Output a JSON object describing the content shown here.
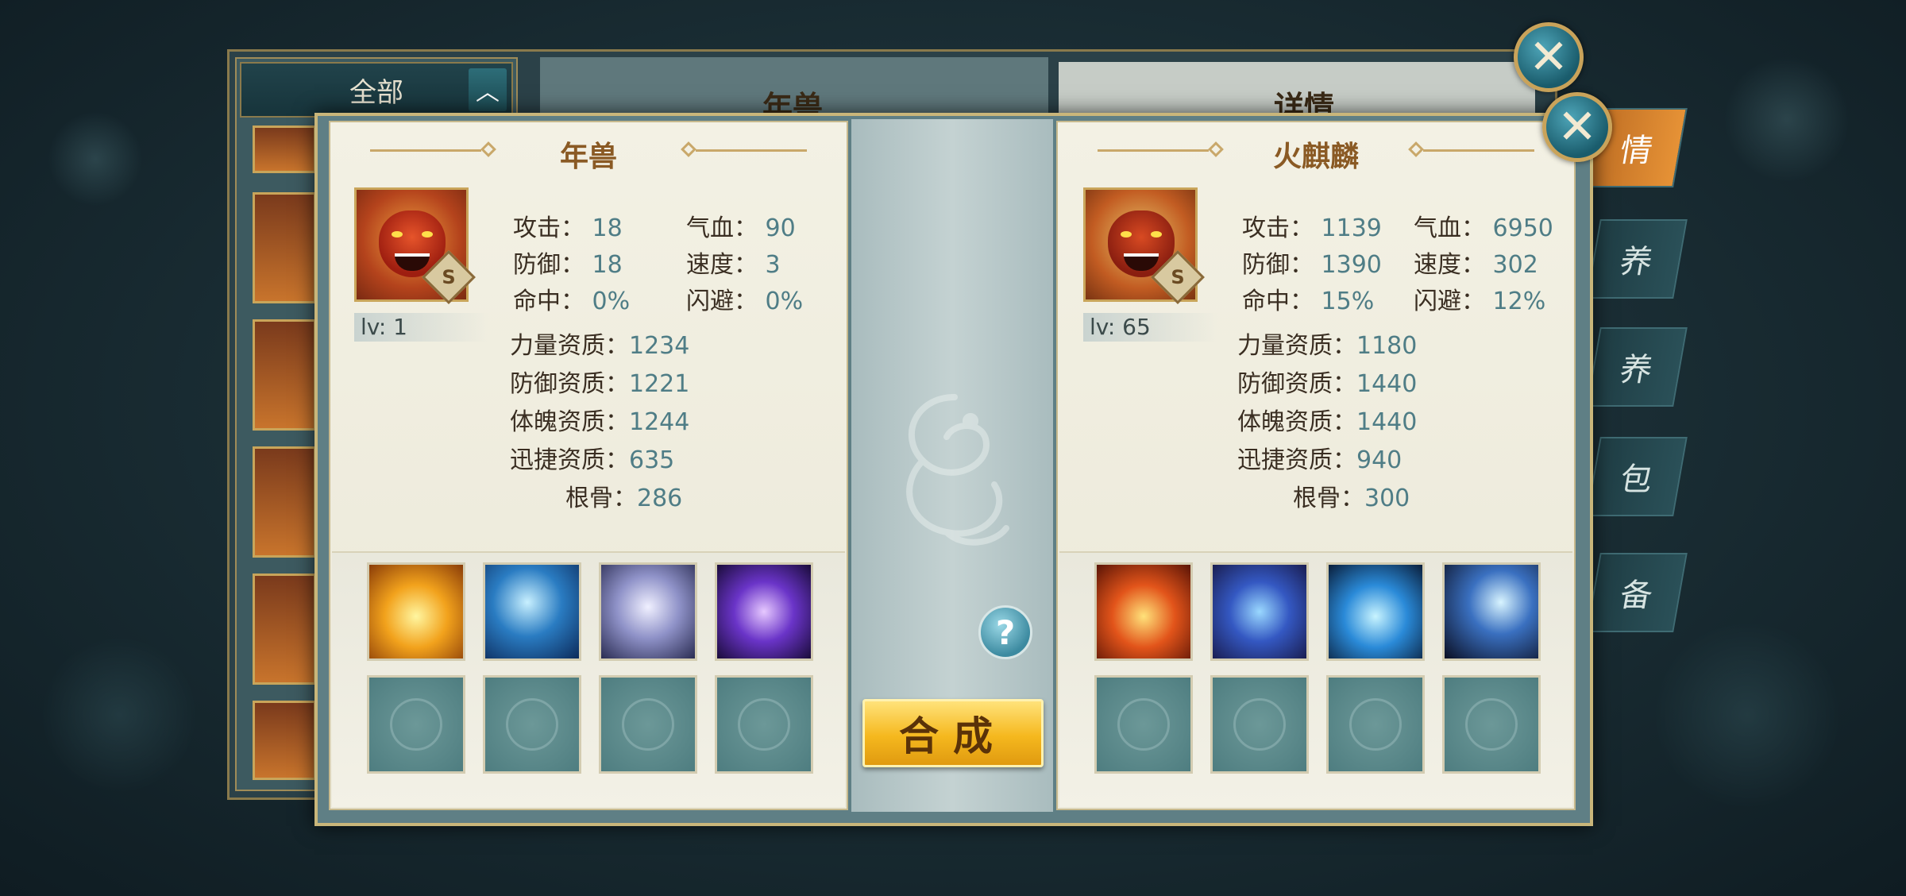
{
  "background_window": {
    "filter_label": "全部",
    "center_title": "年兽",
    "detail_title": "详情",
    "side_tabs": [
      "情",
      "养",
      "养",
      "包",
      "备"
    ]
  },
  "left_pet": {
    "name": "年兽",
    "grade": "S",
    "level": "lv: 1",
    "stats": [
      {
        "label": "攻击：",
        "value": "18"
      },
      {
        "label": "气血：",
        "value": "90"
      },
      {
        "label": "防御：",
        "value": "18"
      },
      {
        "label": "速度：",
        "value": "3"
      },
      {
        "label": "命中：",
        "value": "0%"
      },
      {
        "label": "闪避：",
        "value": "0%"
      }
    ],
    "aptitudes": [
      {
        "label": "力量资质：",
        "value": "1234"
      },
      {
        "label": "防御资质：",
        "value": "1221"
      },
      {
        "label": "体魄资质：",
        "value": "1244"
      },
      {
        "label": "迅捷资质：",
        "value": "635"
      },
      {
        "label": "根骨：",
        "value": "286"
      }
    ],
    "skills": [
      "golden-burst-skill-icon",
      "lightning-moon-skill-icon",
      "wind-orb-skill-icon",
      "purple-pillar-skill-icon"
    ]
  },
  "right_pet": {
    "name": "火麒麟",
    "grade": "S",
    "level": "lv: 65",
    "stats": [
      {
        "label": "攻击：",
        "value": "1139"
      },
      {
        "label": "气血：",
        "value": "6950"
      },
      {
        "label": "防御：",
        "value": "1390"
      },
      {
        "label": "速度：",
        "value": "302"
      },
      {
        "label": "命中：",
        "value": "15%"
      },
      {
        "label": "闪避：",
        "value": "12%"
      }
    ],
    "aptitudes": [
      {
        "label": "力量资质：",
        "value": "1180"
      },
      {
        "label": "防御资质：",
        "value": "1440"
      },
      {
        "label": "体魄资质：",
        "value": "1440"
      },
      {
        "label": "迅捷资质：",
        "value": "940"
      },
      {
        "label": "根骨：",
        "value": "300"
      }
    ],
    "skills": [
      "flame-burst-skill-icon",
      "shield-skill-icon",
      "water-heart-skill-icon",
      "claw-slash-skill-icon"
    ]
  },
  "actions": {
    "merge_label": "合成",
    "help_label": "?",
    "close_label": "✕"
  },
  "colors": {
    "accent_gold": "#f5b81e",
    "value_teal": "#4f7d86",
    "title_brown": "#8a5a24"
  }
}
